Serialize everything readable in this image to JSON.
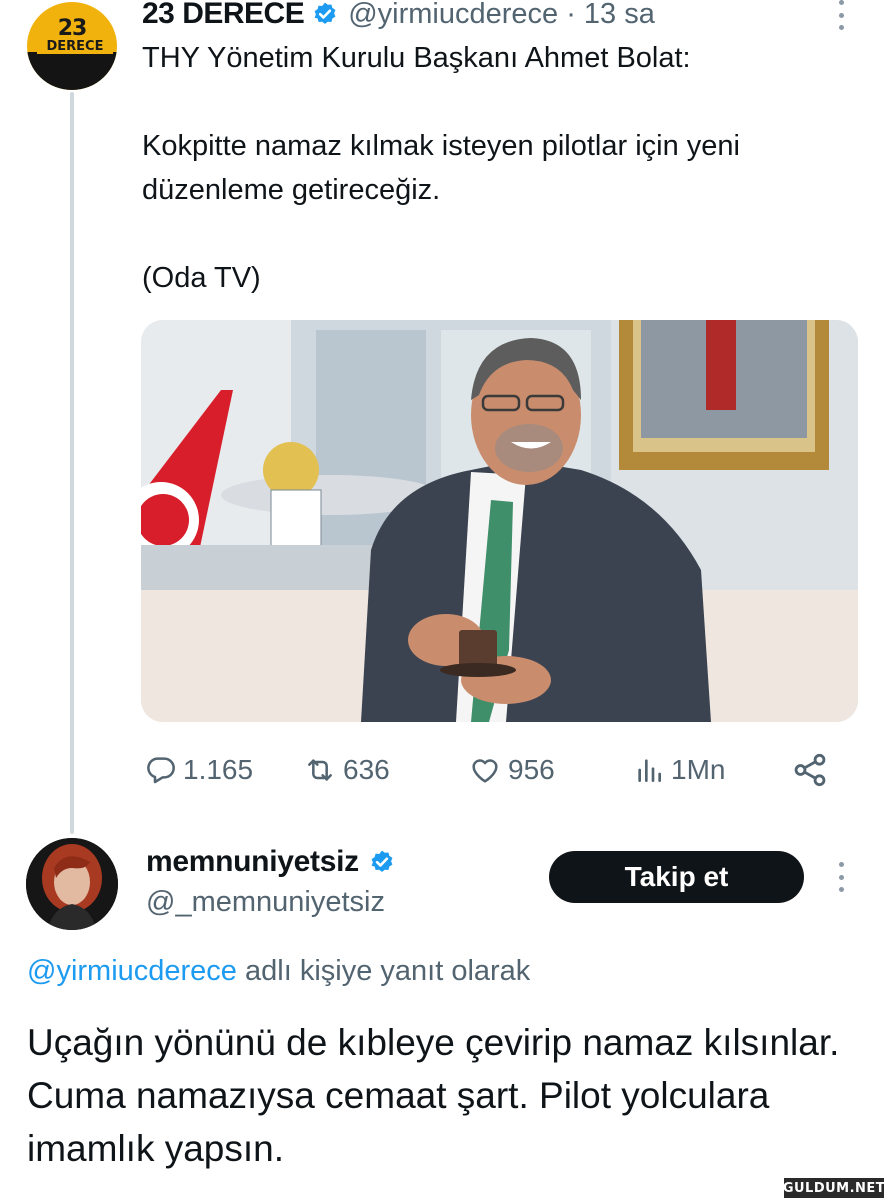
{
  "tweet": {
    "author_name": "23 DERECE",
    "author_handle": "@yirmiucderece",
    "timestamp": "· 13 sa",
    "avatar_number": "23",
    "avatar_word": "DERECE",
    "text": "THY Yönetim Kurulu Başkanı Ahmet Bolat:\n\nKokpitte namaz kılmak isteyen pilotlar için yeni düzenleme getireceğiz.\n\n(Oda TV)",
    "stats": {
      "replies": "1.165",
      "retweets": "636",
      "likes": "956",
      "views": "1Mn"
    }
  },
  "reply": {
    "author_name": "memnuniyetsiz",
    "author_handle": "@_memnuniyetsiz",
    "follow_label": "Takip et",
    "reply_to_mention": "@yirmiucderece",
    "reply_to_suffix": " adlı kişiye yanıt olarak",
    "text": "Uçağın yönünü de kıbleye çevirip namaz kılsınlar. Cuma namazıysa cemaat şart. Pilot yolculara imamlık yapsın."
  },
  "watermark": "GULDUM.NET",
  "colors": {
    "accent": "#1d9bf0",
    "text_primary": "#0f1419",
    "text_secondary": "#536471",
    "follow_button": "#0f1419",
    "thread_line": "#cfd9de"
  },
  "icons": [
    "more-icon",
    "verified-badge-icon",
    "reply-icon",
    "retweet-icon",
    "like-icon",
    "views-icon",
    "share-icon"
  ]
}
